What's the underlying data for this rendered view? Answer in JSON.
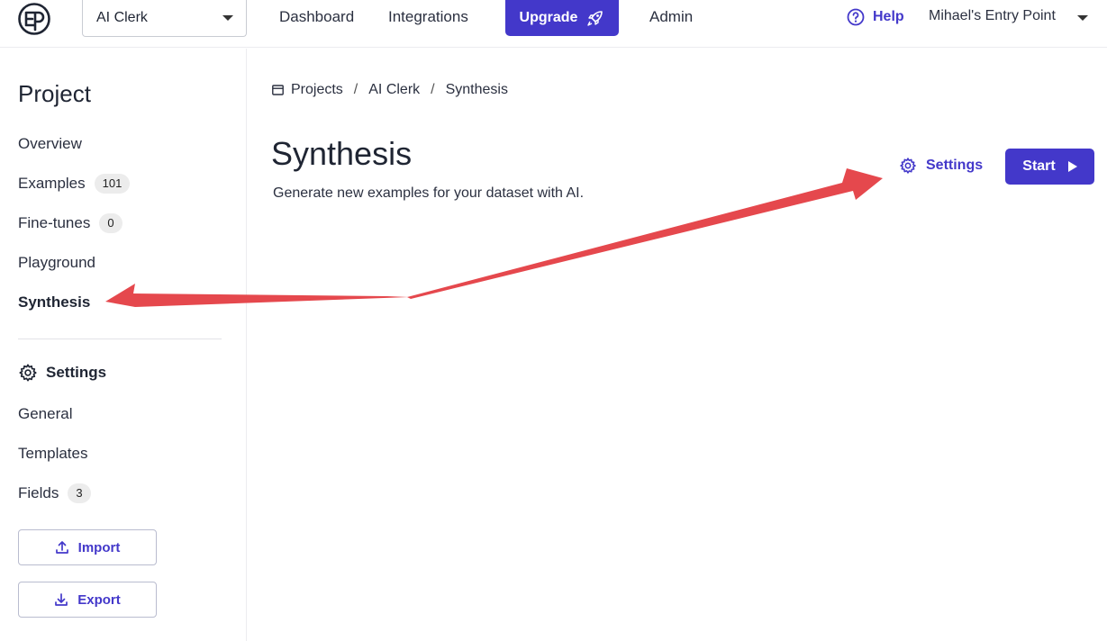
{
  "topbar": {
    "project_selector": "AI Clerk",
    "nav": [
      "Dashboard",
      "Integrations",
      "Admin"
    ],
    "upgrade_label": "Upgrade",
    "help_label": "Help",
    "user_label": "Mihael's Entry Point"
  },
  "sidebar": {
    "title": "Project",
    "items": [
      {
        "label": "Overview"
      },
      {
        "label": "Examples",
        "badge": "101"
      },
      {
        "label": "Fine-tunes",
        "badge": "0"
      },
      {
        "label": "Playground"
      },
      {
        "label": "Synthesis"
      }
    ],
    "settings_heading": "Settings",
    "settings_items": [
      {
        "label": "General"
      },
      {
        "label": "Templates"
      },
      {
        "label": "Fields",
        "badge": "3"
      }
    ],
    "import_label": "Import",
    "export_label": "Export"
  },
  "breadcrumb": [
    "Projects",
    "AI Clerk",
    "Synthesis"
  ],
  "main": {
    "title": "Synthesis",
    "subtitle": "Generate new examples for your dataset with AI.",
    "settings_label": "Settings",
    "start_label": "Start"
  },
  "colors": {
    "accent": "#4338ca",
    "annotation_arrow": "#e5484d"
  }
}
